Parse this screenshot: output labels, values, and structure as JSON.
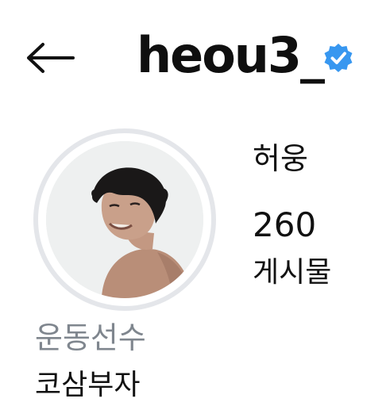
{
  "header": {
    "back_icon": "arrow-left-icon",
    "username": "heou3_",
    "verified_icon": "verified-badge-icon",
    "verified_color": "#3797f0"
  },
  "profile": {
    "avatar": "profile-photo",
    "name": "허웅",
    "posts_count": "260",
    "posts_label": "게시물",
    "category": "운동선수",
    "bio": "코삼부자"
  }
}
